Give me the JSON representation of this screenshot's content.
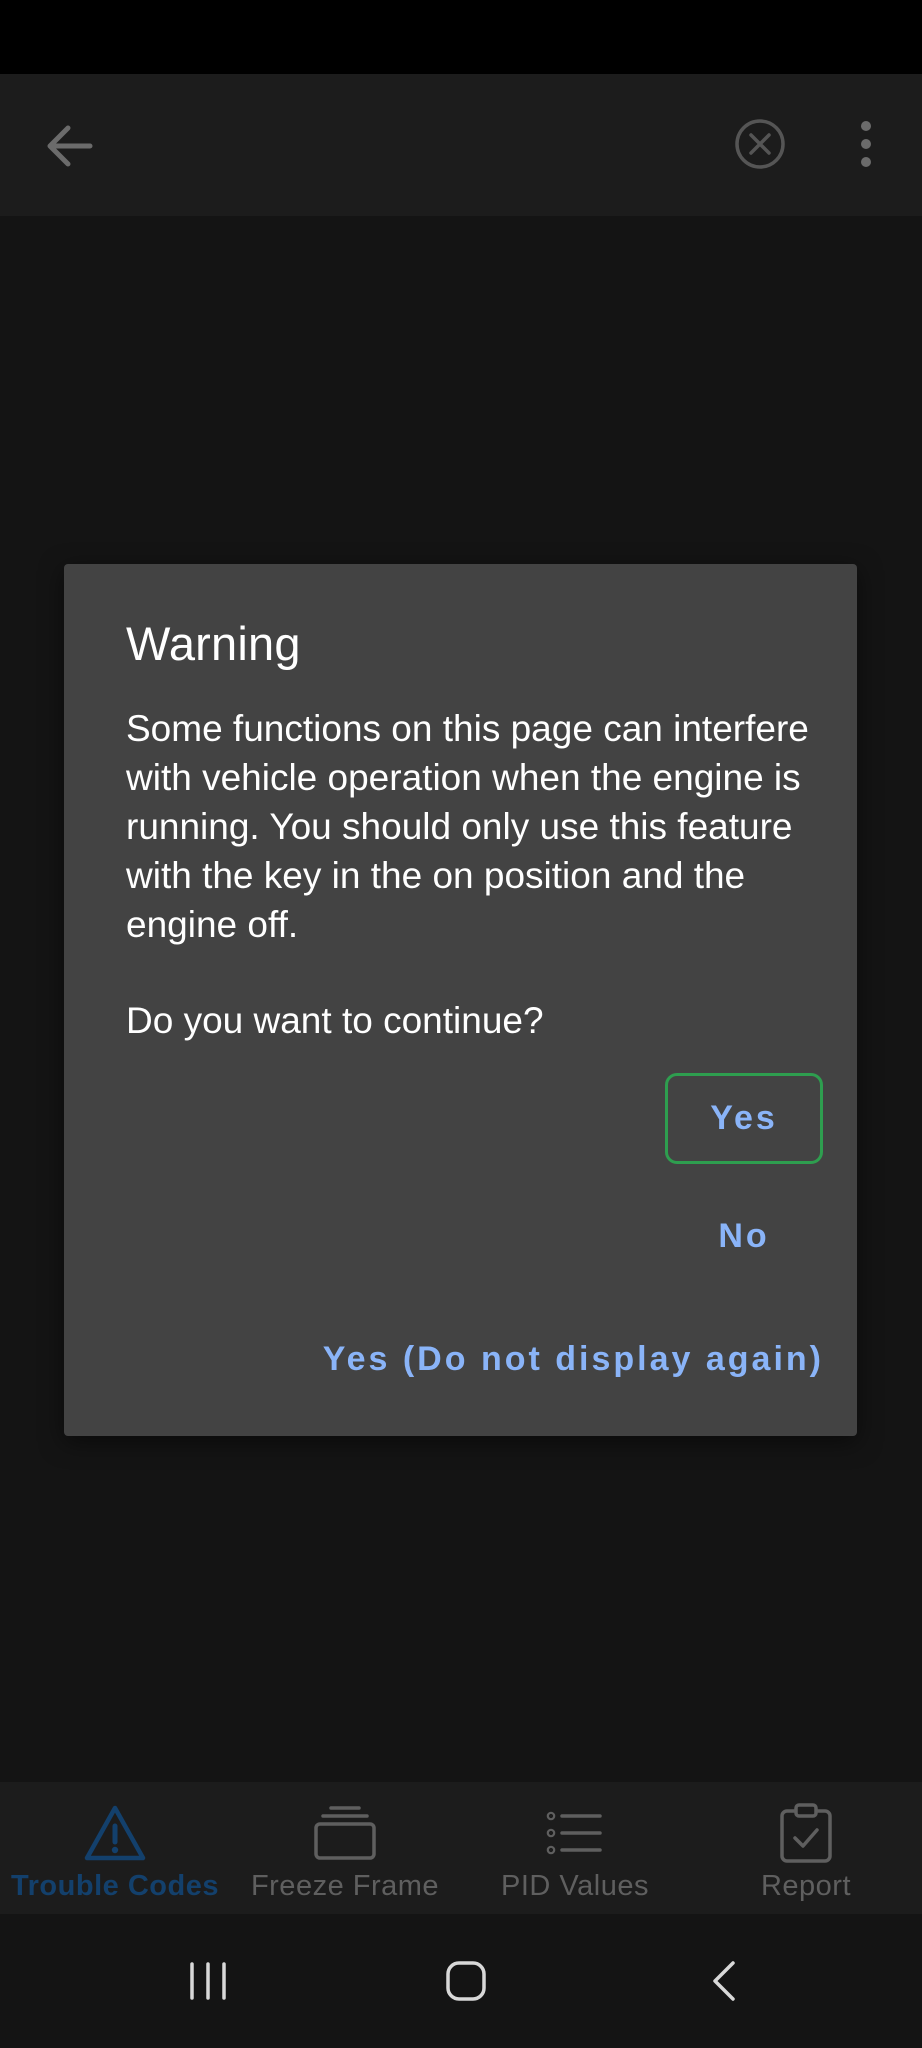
{
  "app_bar": {
    "back_icon": "arrow-left-icon",
    "clear_icon": "circle-x-icon",
    "more_icon": "vertical-dots-icon"
  },
  "dialog": {
    "title": "Warning",
    "message": "Some functions on this page can interfere with vehicle operation when the engine is running. You should only use this feature with the key in the on position and the engine off.",
    "question": "Do you want to continue?",
    "buttons": {
      "yes": "Yes",
      "no": "No",
      "yes_never": "Yes (Do not display again)"
    }
  },
  "bottom_nav": {
    "items": [
      {
        "label": "Trouble Codes",
        "icon": "warning-triangle-icon",
        "active": true
      },
      {
        "label": "Freeze Frame",
        "icon": "stacked-frames-icon",
        "active": false
      },
      {
        "label": "PID Values",
        "icon": "list-icon",
        "active": false
      },
      {
        "label": "Report",
        "icon": "clipboard-check-icon",
        "active": false
      }
    ]
  },
  "system_nav": {
    "recents_icon": "recent-apps-icon",
    "home_icon": "home-icon",
    "back_icon": "back-chevron-icon"
  },
  "colors": {
    "accent_text": "#8ab4f8",
    "focus_border": "#2e9e4f",
    "dialog_bg": "#434343",
    "active_nav": "#13406c"
  }
}
